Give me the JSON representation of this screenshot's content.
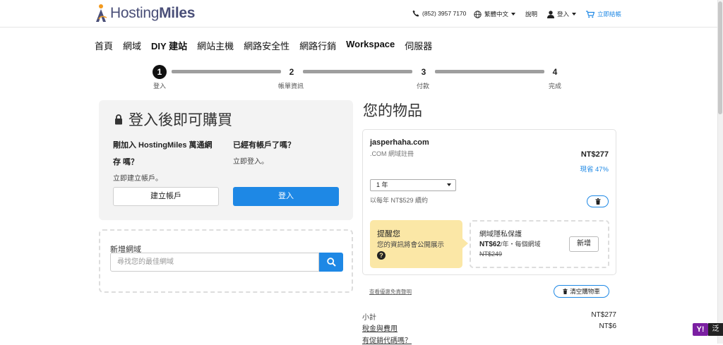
{
  "brand": {
    "name_part1": "Hosting",
    "name_part2": "Miles"
  },
  "header": {
    "phone": "(852) 3957 7170",
    "language": "繁體中文",
    "help": "說明",
    "login": "登入",
    "checkout": "立即結帳"
  },
  "nav": [
    "首頁",
    "網域",
    "DIY 建站",
    "網站主機",
    "網路安全性",
    "網路行銷",
    "Workspace",
    "伺服器"
  ],
  "steps": [
    {
      "num": "1",
      "label": "登入"
    },
    {
      "num": "2",
      "label": "帳單資訊"
    },
    {
      "num": "3",
      "label": "付款"
    },
    {
      "num": "4",
      "label": "完成"
    }
  ],
  "login_panel": {
    "title": "登入後即可購買",
    "new_heading": "剛加入 HostingMiles 萬通網存 嗎？",
    "new_heading_line1": "剛加入 HostingMiles 萬通網",
    "new_heading_line2": "存 嗎？",
    "new_sub": "立即建立帳戶。",
    "existing_heading": "已經有帳戶了嗎？",
    "existing_sub": "立即登入。",
    "create_button": "建立帳戶",
    "login_button": "登入"
  },
  "add_domain": {
    "label": "新增網域",
    "placeholder": "尋找您的最佳網域"
  },
  "cart": {
    "title": "您的物品",
    "item": {
      "domain": "jasperhaha.com",
      "type": ".COM 網域註冊",
      "price": "NT$277",
      "savings": "現省 47%",
      "term": "1 年",
      "renewal": "以每年 NT$529 續約"
    },
    "reminder": {
      "title": "提醒您",
      "text": "您的資訊將會公開展示",
      "help_glyph": "?"
    },
    "privacy": {
      "title": "網域隱私保護",
      "price": "NT$62",
      "price_suffix": "/年・每個網域",
      "old_price": "NT$249",
      "add_button": "新增"
    },
    "terms_link": "查看優惠免責聲明",
    "clear_button": "清空購物車",
    "subtotal_label": "小計",
    "subtotal_value": "NT$277",
    "fees_label": "稅金與費用",
    "fees_value": "NT$6",
    "promo_label": "有促銷代碼嗎？"
  },
  "overlay": {
    "yahoo": "Y!",
    "side": "泛"
  },
  "colors": {
    "accent": "#1e88e5",
    "reminder_bg": "#fbe7a6",
    "logo_text": "#4a4f78"
  }
}
